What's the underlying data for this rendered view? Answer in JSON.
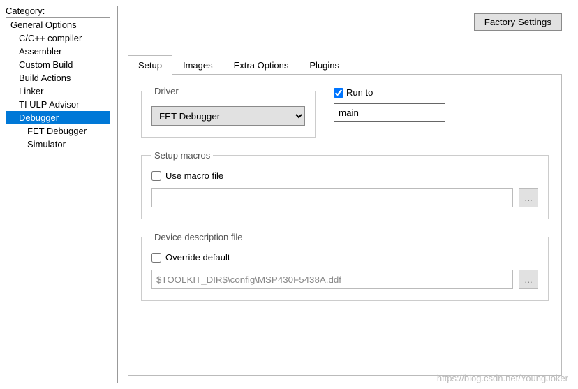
{
  "sidebar": {
    "label": "Category:",
    "items": [
      {
        "label": "General Options",
        "level": 0
      },
      {
        "label": "C/C++ compiler",
        "level": 1
      },
      {
        "label": "Assembler",
        "level": 1
      },
      {
        "label": "Custom Build",
        "level": 1
      },
      {
        "label": "Build Actions",
        "level": 1
      },
      {
        "label": "Linker",
        "level": 1
      },
      {
        "label": "TI ULP Advisor",
        "level": 1
      },
      {
        "label": "Debugger",
        "level": 1,
        "selected": true
      },
      {
        "label": "FET Debugger",
        "level": 2
      },
      {
        "label": "Simulator",
        "level": 2
      }
    ]
  },
  "header": {
    "factory_settings": "Factory Settings"
  },
  "tabs": {
    "items": [
      "Setup",
      "Images",
      "Extra Options",
      "Plugins"
    ],
    "active": 0
  },
  "setup": {
    "driver_group": "Driver",
    "driver_selected": "FET Debugger",
    "runto_label": "Run to",
    "runto_checked": true,
    "runto_value": "main",
    "macros_group": "Setup macros",
    "use_macro_label": "Use macro file",
    "use_macro_checked": false,
    "macro_path": "",
    "browse": "...",
    "ddf_group": "Device description file",
    "override_label": "Override default",
    "override_checked": false,
    "ddf_path": "$TOOLKIT_DIR$\\config\\MSP430F5438A.ddf"
  },
  "watermark": "https://blog.csdn.net/YoungJoker"
}
